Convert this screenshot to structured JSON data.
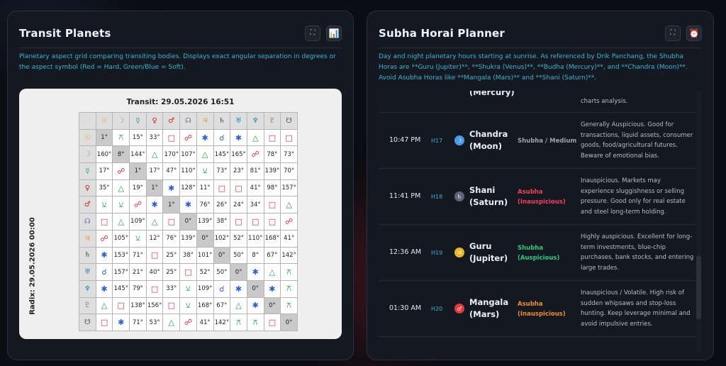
{
  "transit_panel": {
    "title": "Transit Planets",
    "expand_icon": "expand-icon",
    "chart_icon": "bar-chart-icon",
    "description": "Planetary aspect grid comparing transiting bodies. Displays exact angular separation in degrees or the aspect symbol (Red = Hard, Green/Blue = Soft).",
    "chart_title": "Transit: 29.05.2026 16:51",
    "radix_label": "Radix: 29.05.2026 00:00",
    "colors": {
      "hard": "#d42828",
      "soft_green": "#1a9a3c",
      "soft_blue": "#2b5fd9",
      "neutral": "#222222"
    },
    "planets": [
      {
        "glyph": "☉",
        "color": "#e8a317"
      },
      {
        "glyph": "☽",
        "color": "#8f9bb3"
      },
      {
        "glyph": "☿",
        "color": "#1fa3a3"
      },
      {
        "glyph": "♀",
        "color": "#cc2222"
      },
      {
        "glyph": "♂",
        "color": "#cc2222"
      },
      {
        "glyph": "☊",
        "color": "#7a6a9a"
      },
      {
        "glyph": "♃",
        "color": "#e8a317"
      },
      {
        "glyph": "♄",
        "color": "#444444"
      },
      {
        "glyph": "♅",
        "color": "#1f8ab5"
      },
      {
        "glyph": "♆",
        "color": "#1f8ab5"
      },
      {
        "glyph": "♇",
        "color": "#7d7d9a"
      },
      {
        "glyph": "☋",
        "color": "#555555"
      }
    ],
    "grid": [
      [
        "1°",
        "⚻",
        "15°",
        "33°",
        "□",
        "☍",
        "✱",
        "☌",
        "✱",
        "△",
        "□",
        "□"
      ],
      [
        "160°",
        "8°",
        "144°",
        "△",
        "170°",
        "107°",
        "△",
        "145°",
        "165°",
        "☍",
        "78°",
        "73°"
      ],
      [
        "17°",
        "☍",
        "1°",
        "17°",
        "47°",
        "110°",
        "⚺",
        "73°",
        "23°",
        "81°",
        "139°",
        "70°"
      ],
      [
        "35°",
        "△",
        "19°",
        "1°",
        "✱",
        "128°",
        "11°",
        "□",
        "□",
        "41°",
        "98°",
        "157°"
      ],
      [
        "⚺",
        "⚺",
        "☍",
        "✱",
        "1°",
        "✱",
        "76°",
        "26°",
        "24°",
        "34°",
        "□",
        "△"
      ],
      [
        "□",
        "△",
        "109°",
        "△",
        "□",
        "0°",
        "139°",
        "38°",
        "□",
        "□",
        "□",
        "☍"
      ],
      [
        "☍",
        "105°",
        "⚺",
        "12°",
        "76°",
        "139°",
        "0°",
        "102°",
        "52°",
        "110°",
        "168°",
        "41°"
      ],
      [
        "✱",
        "153°",
        "71°",
        "□",
        "25°",
        "38°",
        "101°",
        "0°",
        "50°",
        "8°",
        "67°",
        "142°"
      ],
      [
        "☌",
        "157°",
        "21°",
        "40°",
        "25°",
        "□",
        "52°",
        "50°",
        "0°",
        "✱",
        "△",
        "⚻"
      ],
      [
        "✱",
        "145°",
        "79°",
        "□",
        "33°",
        "⚺",
        "109°",
        "☌",
        "✱",
        "0°",
        "✱",
        "⚻"
      ],
      [
        "△",
        "□",
        "138°",
        "156°",
        "□",
        "⚺",
        "168°",
        "67°",
        "△",
        "✱",
        "0°",
        "⚻"
      ],
      [
        "□",
        "✱",
        "71°",
        "53°",
        "△",
        "☍",
        "41°",
        "142°",
        "⚻",
        "⚻",
        "□",
        "0°"
      ]
    ]
  },
  "horai_panel": {
    "title": "Subha Horai Planner",
    "expand_icon": "expand-icon",
    "clock_icon": "alarm-clock-icon",
    "description": "Day and night planetary hours starting at sunrise. As referenced by Drik Panchang, the Shubha Horas are **Guru (Jupiter)**, **Shukra (Venus)**, **Budha (Mercury)**, and **Chandra (Moon)**. Avoid Asubha Horas like **Mangala (Mars)** and **Shani (Saturn)**.",
    "partial_row": {
      "planet_partial": "(Mercury)",
      "note_partial": "charts analysis."
    },
    "rows": [
      {
        "time": "10:47 PM",
        "hora": "H17",
        "glyph": "☽",
        "dot_color": "#4c9be8",
        "planet": "Chandra",
        "planet_en": "(Moon)",
        "status": "Shubha / Medium",
        "status_color": "#9aa3b2",
        "note": "Generally Auspicious. Good for transactions, liquid assets, consumer goods, food/agricultural futures. Beware of emotional bias."
      },
      {
        "time": "11:41 PM",
        "hora": "H18",
        "glyph": "♄",
        "dot_color": "#5d6678",
        "planet": "Shani",
        "planet_en": "(Saturn)",
        "status": "Asubha (Inauspicious)",
        "status_color": "#f0415b",
        "note": "Inauspicious. Markets may experience sluggishness or selling pressure. Good only for real estate and steel long-term holding."
      },
      {
        "time": "12:36 AM",
        "hora": "H19",
        "glyph": "♃",
        "dot_color": "#f0b429",
        "planet": "Guru",
        "planet_en": "(Jupiter)",
        "status": "Shubha (Auspicious)",
        "status_color": "#2ecb7a",
        "note": "Highly auspicious. Excellent for long-term investments, blue-chip purchases, bank stocks, and entering large trades."
      },
      {
        "time": "01:30 AM",
        "hora": "H20",
        "glyph": "♂",
        "dot_color": "#e5383b",
        "planet": "Mangala",
        "planet_en": "(Mars)",
        "status": "Asubha (Inauspicious)",
        "status_color": "#f08c2a",
        "note": "Inauspicious / Volatile. High risk of sudden whipsaws and stop-loss hunting. Keep leverage minimal and avoid impulsive entries."
      }
    ]
  }
}
